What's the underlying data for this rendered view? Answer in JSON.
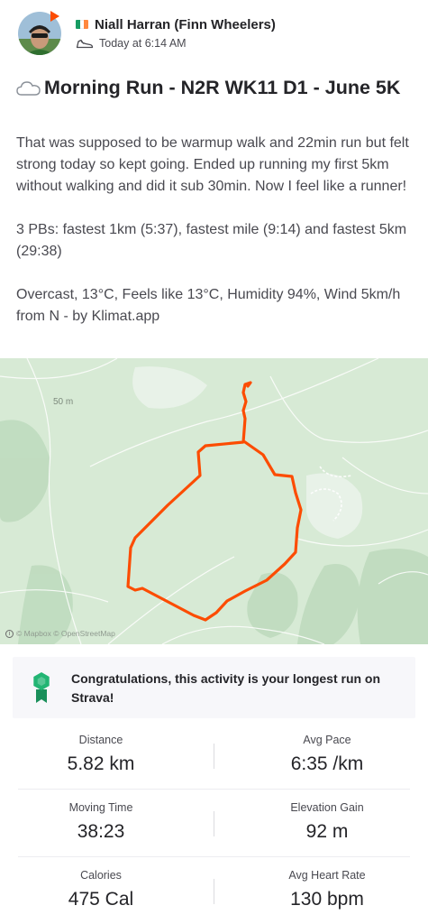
{
  "header": {
    "athlete_name": "Niall Harran (Finn Wheelers)",
    "timestamp": "Today at 6:14 AM",
    "flag_colors": [
      "#169b62",
      "#ffffff",
      "#ff883e"
    ],
    "activity_icon": "shoe-icon"
  },
  "activity": {
    "weather_icon": "cloud-icon",
    "title": "Morning Run - N2R WK11 D1 - June 5K",
    "description": [
      "That was supposed to be warmup walk and 22min run but felt strong today so kept going. Ended up running my first 5km without walking and did it sub 30min. Now I feel like a runner!",
      "3 PBs: fastest 1km (5:37), fastest mile (9:14) and fastest 5km (29:38)",
      "Overcast, 13°C, Feels like 13°C, Humidity 94%, Wind 5km/h from N - by Klimat.app"
    ]
  },
  "map": {
    "elevation_label": "50 m",
    "attribution": "© Mapbox © OpenStreetMap",
    "route_color": "#fc4c02",
    "land_color": "#d7ead5"
  },
  "achievement": {
    "icon": "medal-icon",
    "text": "Congratulations, this activity is your longest run on Strava!",
    "accent_color": "#22b573"
  },
  "stats": [
    {
      "label": "Distance",
      "value": "5.82 km"
    },
    {
      "label": "Avg Pace",
      "value": "6:35 /km"
    },
    {
      "label": "Moving Time",
      "value": "38:23"
    },
    {
      "label": "Elevation Gain",
      "value": "92 m"
    },
    {
      "label": "Calories",
      "value": "475 Cal"
    },
    {
      "label": "Avg Heart Rate",
      "value": "130 bpm"
    }
  ]
}
